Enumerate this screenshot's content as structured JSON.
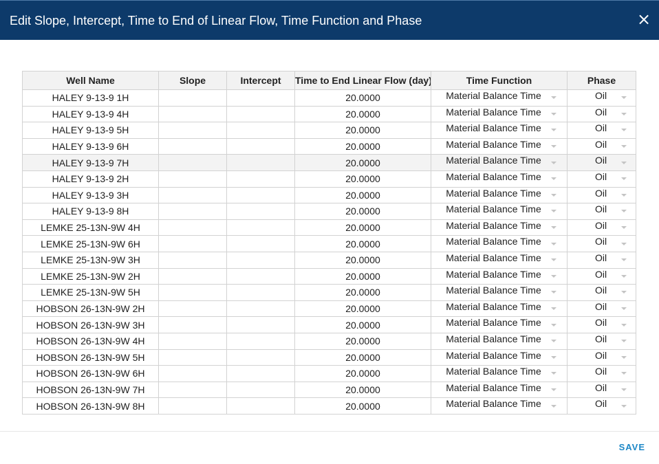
{
  "dialog": {
    "title": "Edit Slope, Intercept, Time to End of Linear Flow, Time Function and Phase",
    "close_icon": "close-icon",
    "save_label": "SAVE"
  },
  "colors": {
    "header_bg": "#0d3a6a",
    "save_accent": "#1e88c7",
    "highlight_row": "#f3f3f3"
  },
  "table": {
    "headers": [
      "Well Name",
      "Slope",
      "Intercept",
      "Time to End Linear Flow (day)",
      "Time Function",
      "Phase"
    ],
    "rows": [
      {
        "well": "HALEY 9-13-9 1H",
        "slope": "",
        "intercept": "",
        "time_end": "20.0000",
        "time_function": "Material Balance Time",
        "phase": "Oil"
      },
      {
        "well": "HALEY 9-13-9 4H",
        "slope": "",
        "intercept": "",
        "time_end": "20.0000",
        "time_function": "Material Balance Time",
        "phase": "Oil"
      },
      {
        "well": "HALEY 9-13-9 5H",
        "slope": "",
        "intercept": "",
        "time_end": "20.0000",
        "time_function": "Material Balance Time",
        "phase": "Oil"
      },
      {
        "well": "HALEY 9-13-9 6H",
        "slope": "",
        "intercept": "",
        "time_end": "20.0000",
        "time_function": "Material Balance Time",
        "phase": "Oil"
      },
      {
        "well": "HALEY 9-13-9 7H",
        "slope": "",
        "intercept": "",
        "time_end": "20.0000",
        "time_function": "Material Balance Time",
        "phase": "Oil",
        "highlighted": true
      },
      {
        "well": "HALEY 9-13-9 2H",
        "slope": "",
        "intercept": "",
        "time_end": "20.0000",
        "time_function": "Material Balance Time",
        "phase": "Oil"
      },
      {
        "well": "HALEY 9-13-9 3H",
        "slope": "",
        "intercept": "",
        "time_end": "20.0000",
        "time_function": "Material Balance Time",
        "phase": "Oil"
      },
      {
        "well": "HALEY 9-13-9 8H",
        "slope": "",
        "intercept": "",
        "time_end": "20.0000",
        "time_function": "Material Balance Time",
        "phase": "Oil"
      },
      {
        "well": "LEMKE 25-13N-9W 4H",
        "slope": "",
        "intercept": "",
        "time_end": "20.0000",
        "time_function": "Material Balance Time",
        "phase": "Oil"
      },
      {
        "well": "LEMKE 25-13N-9W 6H",
        "slope": "",
        "intercept": "",
        "time_end": "20.0000",
        "time_function": "Material Balance Time",
        "phase": "Oil"
      },
      {
        "well": "LEMKE 25-13N-9W 3H",
        "slope": "",
        "intercept": "",
        "time_end": "20.0000",
        "time_function": "Material Balance Time",
        "phase": "Oil"
      },
      {
        "well": "LEMKE 25-13N-9W 2H",
        "slope": "",
        "intercept": "",
        "time_end": "20.0000",
        "time_function": "Material Balance Time",
        "phase": "Oil"
      },
      {
        "well": "LEMKE 25-13N-9W 5H",
        "slope": "",
        "intercept": "",
        "time_end": "20.0000",
        "time_function": "Material Balance Time",
        "phase": "Oil"
      },
      {
        "well": "HOBSON 26-13N-9W 2H",
        "slope": "",
        "intercept": "",
        "time_end": "20.0000",
        "time_function": "Material Balance Time",
        "phase": "Oil"
      },
      {
        "well": "HOBSON 26-13N-9W 3H",
        "slope": "",
        "intercept": "",
        "time_end": "20.0000",
        "time_function": "Material Balance Time",
        "phase": "Oil"
      },
      {
        "well": "HOBSON 26-13N-9W 4H",
        "slope": "",
        "intercept": "",
        "time_end": "20.0000",
        "time_function": "Material Balance Time",
        "phase": "Oil"
      },
      {
        "well": "HOBSON 26-13N-9W 5H",
        "slope": "",
        "intercept": "",
        "time_end": "20.0000",
        "time_function": "Material Balance Time",
        "phase": "Oil"
      },
      {
        "well": "HOBSON 26-13N-9W 6H",
        "slope": "",
        "intercept": "",
        "time_end": "20.0000",
        "time_function": "Material Balance Time",
        "phase": "Oil"
      },
      {
        "well": "HOBSON 26-13N-9W 7H",
        "slope": "",
        "intercept": "",
        "time_end": "20.0000",
        "time_function": "Material Balance Time",
        "phase": "Oil"
      },
      {
        "well": "HOBSON 26-13N-9W 8H",
        "slope": "",
        "intercept": "",
        "time_end": "20.0000",
        "time_function": "Material Balance Time",
        "phase": "Oil"
      }
    ]
  }
}
